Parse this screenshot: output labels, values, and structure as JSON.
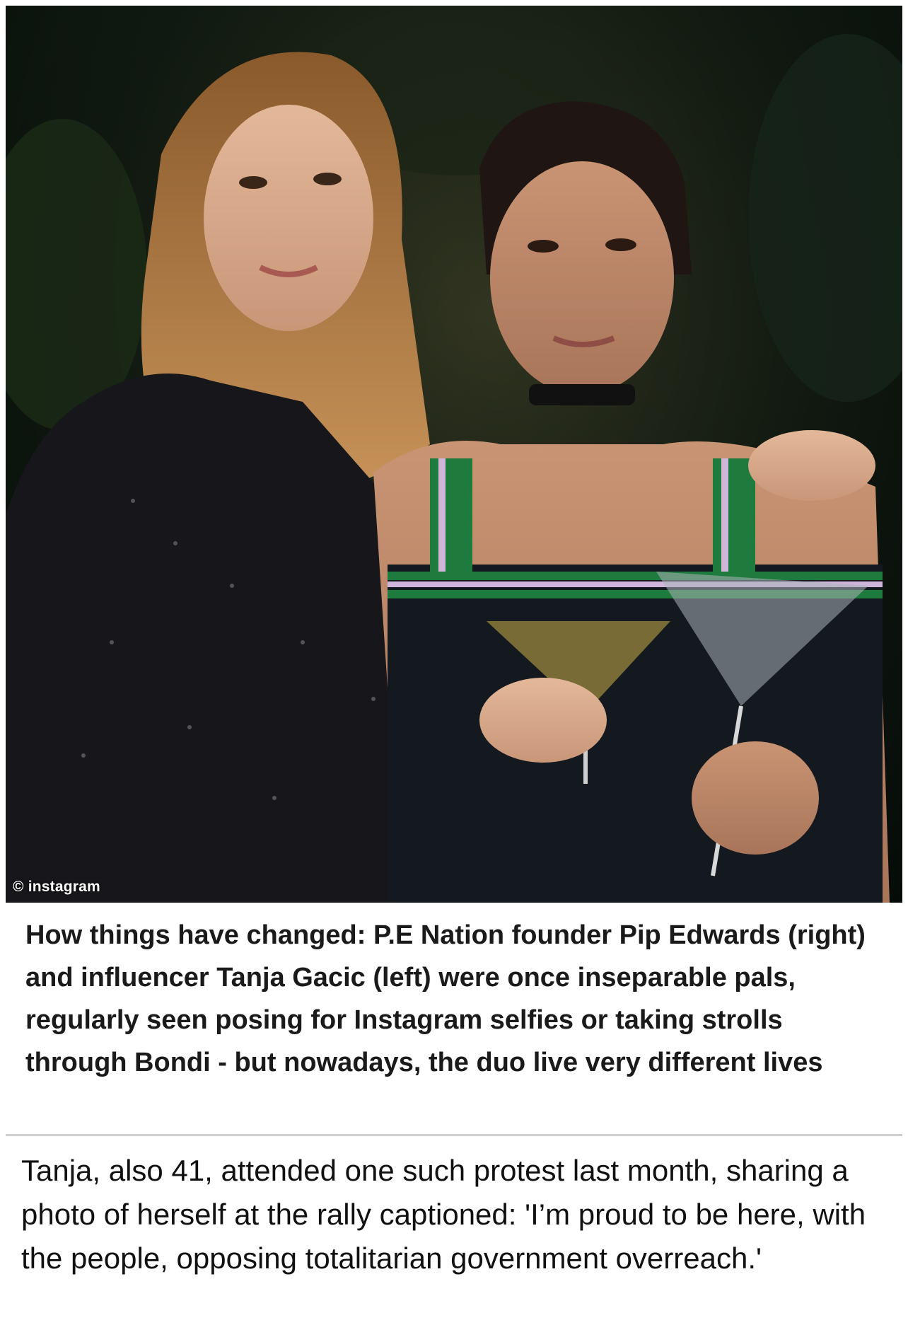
{
  "photo": {
    "credit": "© instagram"
  },
  "caption": {
    "text": "How things have changed: P.E Nation founder Pip Edwards (right) and influencer Tanja Gacic (left) were once inseparable pals, regularly seen posing for Instagram selfies or taking strolls through Bondi - but nowadays, the duo live very different lives"
  },
  "article": {
    "paragraph": "Tanja, also 41, attended one such protest last month, sharing a photo of herself at the rally captioned: 'I’m proud to be here, with the people, opposing totalitarian government overreach.'"
  },
  "colors": {
    "caption_text": "#1a1a1a",
    "divider": "#cfcfcf",
    "photo_background": "#0c140e"
  }
}
